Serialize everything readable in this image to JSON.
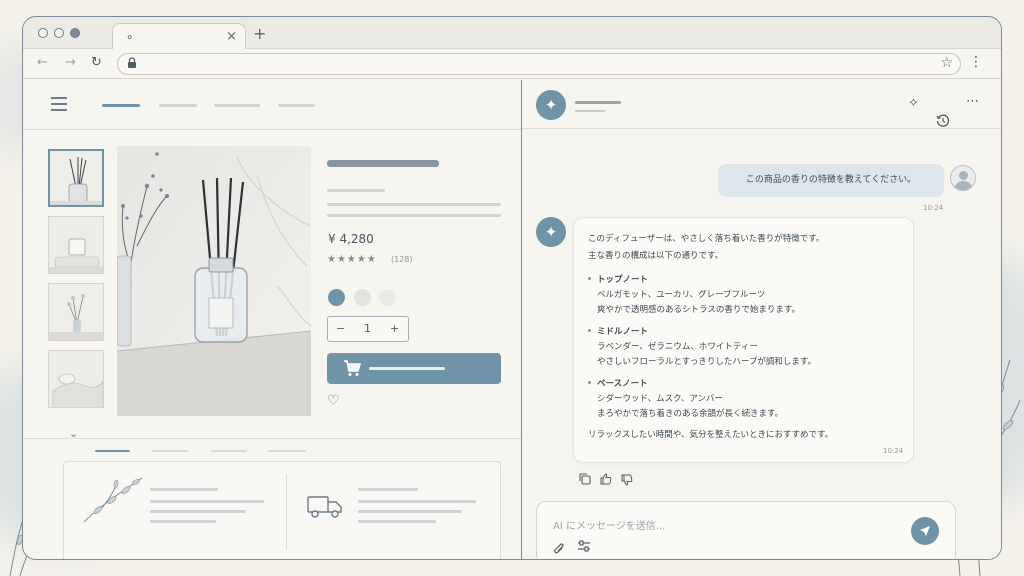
{
  "colors": {
    "accent": "#6f94a8",
    "frame": "#7a8893",
    "bg": "#f4f1ea"
  },
  "browser": {
    "tab_icon": "globe-icon",
    "close_glyph": "×",
    "new_tab_glyph": "+",
    "back_glyph": "←",
    "forward_glyph": "→",
    "reload_glyph": "↻",
    "star_glyph": "☆",
    "menu_glyph": "⋮"
  },
  "product": {
    "price": "¥ 4,280",
    "stars": "★★★★★",
    "rating_count": "(128)",
    "rating_value": 4.5,
    "quantity": "1",
    "minus": "−",
    "plus": "+",
    "scroll_down": "⌄",
    "heart": "♡",
    "swatches": [
      "#6f94a8",
      "#e2e2df",
      "#e9e9e6"
    ],
    "selected_swatch": 0
  },
  "chat": {
    "header_icons": [
      "sparkle-icon",
      "history-icon",
      "more-icon"
    ],
    "user_message": "この商品の香りの特徴を教えてください。",
    "user_time": "10:24",
    "ai_intro_1": "このディフューザーは、やさしく落ち着いた香りが特徴です。",
    "ai_intro_2": "主な香りの構成は以下の通りです。",
    "notes": [
      {
        "title": "トップノート",
        "line1": "ベルガモット、ユーカリ、グレープフルーツ",
        "line2": "爽やかで透明感のあるシトラスの香りで始まります。"
      },
      {
        "title": "ミドルノート",
        "line1": "ラベンダー、ゼラニウム、ホワイトティー",
        "line2": "やさしいフローラルとすっきりしたハーブが調和します。"
      },
      {
        "title": "ベースノート",
        "line1": "シダーウッド、ムスク、アンバー",
        "line2": "まろやかで落ち着きのある余韻が長く続きます。"
      }
    ],
    "ai_outro": "リラックスしたい時間や、気分を整えたいときにおすすめです。",
    "ai_time": "10:24",
    "input_placeholder": "AI にメッセージを送信..."
  }
}
